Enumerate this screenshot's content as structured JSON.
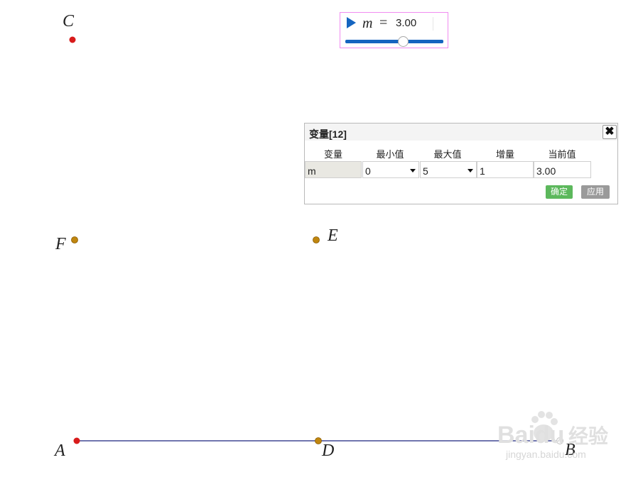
{
  "canvas": {
    "points": {
      "C": {
        "label": "C",
        "color": "#d81b1b"
      },
      "F": {
        "label": "F",
        "color": "#c0860f"
      },
      "E": {
        "label": "E",
        "color": "#c0860f"
      },
      "A": {
        "label": "A",
        "color": "#d81b1b"
      },
      "D": {
        "label": "D",
        "color": "#c0860f"
      },
      "B": {
        "label": "B",
        "color": "#ffffff"
      }
    },
    "segment_color": "#1a237e"
  },
  "slider": {
    "variable": "m",
    "equals": "=",
    "value_text": "3.00",
    "value": 3,
    "min": 0,
    "max": 5,
    "track_color": "#1565c0",
    "border_color": "#f08cf0"
  },
  "dialog": {
    "title": "变量[12]",
    "close_glyph": "✖",
    "columns": [
      "变量",
      "最小值",
      "最大值",
      "增量",
      "当前值"
    ],
    "row": {
      "variable": "m",
      "min": "0",
      "max": "5",
      "step": "1",
      "current": "3.00"
    },
    "ok_label": "确定",
    "apply_label": "应用",
    "ok_color": "#5cb85c",
    "apply_color": "#9a9a9a"
  },
  "watermark": {
    "brand": "Baidu",
    "brand_cn": "经验",
    "url": "jingyan.baidu.com"
  }
}
